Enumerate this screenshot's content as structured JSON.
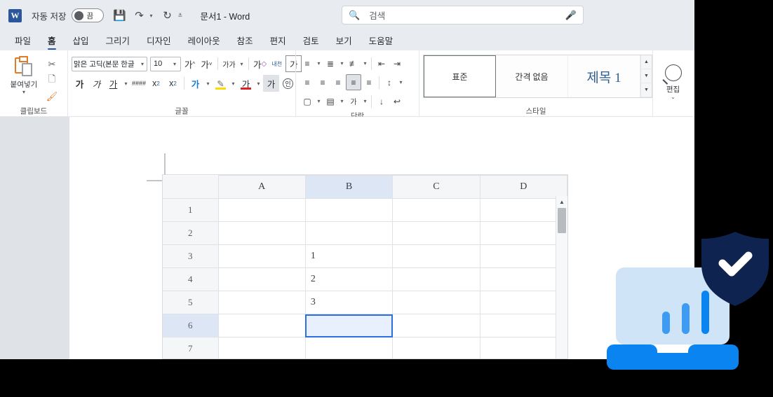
{
  "titlebar": {
    "app_logo": "word-logo",
    "logo_letter": "W",
    "autosave_label": "자동 저장",
    "autosave_state": "끔",
    "save_icon": "save-icon",
    "undo_icon": "undo-icon",
    "redo_icon": "redo-icon",
    "qat_more_icon": "qat-overflow-icon",
    "document_title": "문서1  -  Word"
  },
  "search": {
    "placeholder": "검색",
    "search_icon": "search-icon",
    "mic_icon": "microphone-icon"
  },
  "tabs": [
    {
      "label": "파일",
      "active": false
    },
    {
      "label": "홈",
      "active": true
    },
    {
      "label": "삽입",
      "active": false
    },
    {
      "label": "그리기",
      "active": false
    },
    {
      "label": "디자인",
      "active": false
    },
    {
      "label": "레이아웃",
      "active": false
    },
    {
      "label": "참조",
      "active": false
    },
    {
      "label": "편지",
      "active": false
    },
    {
      "label": "검토",
      "active": false
    },
    {
      "label": "보기",
      "active": false
    },
    {
      "label": "도움말",
      "active": false
    }
  ],
  "ribbon": {
    "clipboard": {
      "group_label": "클립보드",
      "paste_label": "붙여넣기",
      "cut_icon": "scissors-icon",
      "copy_icon": "copy-icon",
      "format_painter_icon": "format-painter-icon",
      "dialog_launcher": "⊿"
    },
    "font": {
      "group_label": "글꼴",
      "font_name": "맑은 고딕(본문 한글",
      "font_size": "10",
      "grow_font": "가",
      "shrink_font": "가",
      "change_case": "가가",
      "clear_format": "가",
      "phonetic_guide": "내천",
      "char_border": "가",
      "bold": "가",
      "italic": "가",
      "underline": "가",
      "strikethrough": "####",
      "subscript": "x",
      "superscript": "x",
      "text_effects": "가",
      "highlight": "가",
      "font_color": "가",
      "char_shading": "가",
      "enclose_char": "인",
      "dialog_launcher": "⊿"
    },
    "paragraph": {
      "group_label": "단락",
      "bullets_icon": "bullet-list-icon",
      "numbering_icon": "numbered-list-icon",
      "multilevel_icon": "multilevel-list-icon",
      "decrease_indent_icon": "decrease-indent-icon",
      "increase_indent_icon": "increase-indent-icon",
      "align_left_icon": "align-left-icon",
      "align_center_icon": "align-center-icon",
      "align_right_icon": "align-right-icon",
      "justify_icon": "justify-icon",
      "distribute_icon": "distribute-icon",
      "line_spacing_icon": "line-spacing-icon",
      "shading_icon": "shading-icon",
      "borders_icon": "borders-icon",
      "asian_layout_icon": "asian-layout-icon",
      "sort_icon": "sort-icon",
      "show_marks_icon": "show-paragraph-marks-icon",
      "dialog_launcher": "⊿"
    },
    "styles": {
      "group_label": "스타일",
      "items": [
        {
          "label": "표준",
          "selected": true
        },
        {
          "label": "간격 없음",
          "selected": false
        },
        {
          "label": "제목 1",
          "selected": false
        }
      ],
      "scroll_up": "▲",
      "scroll_down": "▼",
      "scroll_more": "▼",
      "dialog_launcher": "⊿"
    },
    "editing": {
      "label": "편집",
      "icon": "magnifier-icon",
      "caret": "⌄"
    }
  },
  "spreadsheet": {
    "column_headers": [
      "A",
      "B",
      "C",
      "D"
    ],
    "selected_column": "B",
    "row_headers": [
      "1",
      "2",
      "3",
      "4",
      "5",
      "6",
      "7"
    ],
    "selected_row": "6",
    "rows": [
      {
        "row": "1",
        "cells": [
          "",
          "",
          "",
          ""
        ]
      },
      {
        "row": "2",
        "cells": [
          "",
          "",
          "",
          ""
        ]
      },
      {
        "row": "3",
        "cells": [
          "",
          "1",
          "",
          ""
        ]
      },
      {
        "row": "4",
        "cells": [
          "",
          "2",
          "",
          ""
        ]
      },
      {
        "row": "5",
        "cells": [
          "",
          "3",
          "",
          ""
        ]
      },
      {
        "row": "6",
        "cells": [
          "",
          "",
          "",
          ""
        ]
      },
      {
        "row": "7",
        "cells": [
          "",
          "",
          "",
          ""
        ]
      }
    ],
    "active_cell": "B6",
    "scroll_up_arrow": "▲"
  },
  "illustration": {
    "name": "secure-laptop-chart-illustration",
    "shield_icon": "shield-check-icon",
    "laptop_icon": "laptop-icon",
    "bar_chart_icon": "bar-chart-icon",
    "colors": {
      "shield": "#0f2350",
      "check": "#ffffff",
      "laptop_screen": "#cfe4f7",
      "laptop_base": "#0a84f0",
      "bar_small": "#3d9bf2",
      "bar_medium": "#3d9bf2",
      "bar_large": "#0a84f0"
    }
  },
  "colors": {
    "accent": "#2b579a",
    "chrome": "#e8ebef",
    "page_background": "#dfe3e8",
    "selection_blue": "#2b6fe0",
    "selection_fill": "#e8f0fd"
  }
}
